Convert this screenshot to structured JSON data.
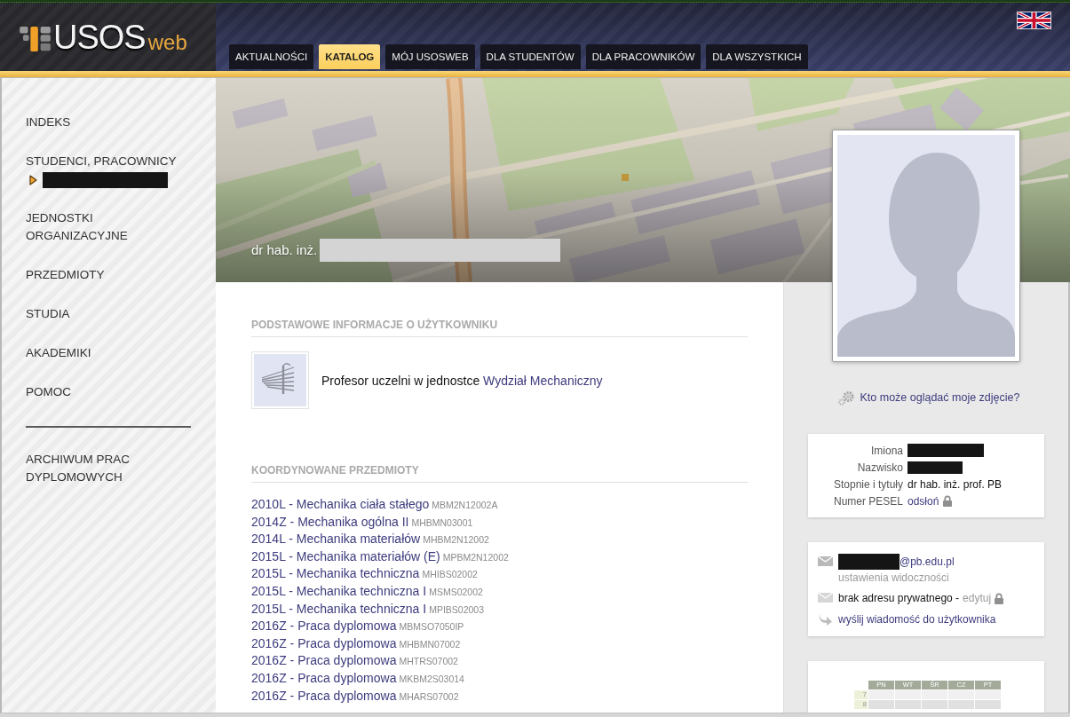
{
  "header": {
    "logo": {
      "main": "USOS",
      "suffix": "web"
    },
    "tabs": [
      {
        "label": "AKTUALNOŚCI",
        "selected": false
      },
      {
        "label": "KATALOG",
        "selected": true
      },
      {
        "label": "MÓJ USOSWEB",
        "selected": false
      },
      {
        "label": "DLA STUDENTÓW",
        "selected": false
      },
      {
        "label": "DLA PRACOWNIKÓW",
        "selected": false
      },
      {
        "label": "DLA WSZYSTKICH",
        "selected": false
      }
    ]
  },
  "sidebar": {
    "sections": [
      {
        "items": [
          {
            "label": "INDEKS",
            "expanded": false
          },
          {
            "label": "STUDENCI, PRACOWNICY",
            "expanded": true
          },
          {
            "label": "JEDNOSTKI ORGANIZACYJNE",
            "expanded": false
          },
          {
            "label": "PRZEDMIOTY",
            "expanded": false
          },
          {
            "label": "STUDIA",
            "expanded": false
          },
          {
            "label": "AKADEMIKI",
            "expanded": false
          },
          {
            "label": "POMOC",
            "expanded": false
          }
        ]
      },
      {
        "items": [
          {
            "label": "ARCHIWUM PRAC DYPLOMOWYCH",
            "expanded": false
          }
        ]
      }
    ]
  },
  "banner": {
    "name_prefix": "dr hab. inż."
  },
  "main": {
    "basic_info": {
      "heading": "PODSTAWOWE INFORMACJE O UŻYTKOWNIKU",
      "position_text": "Profesor uczelni w jednostce",
      "unit_link": "Wydział Mechaniczny"
    },
    "courses": {
      "heading": "KOORDYNOWANE PRZEDMIOTY",
      "items": [
        {
          "title": "2010L - Mechanika ciała stałego",
          "code": "MBM2N12002A"
        },
        {
          "title": "2014Z - Mechanika ogólna II",
          "code": "MHBMN03001"
        },
        {
          "title": "2014L - Mechanika materiałów",
          "code": "MHBM2N12002"
        },
        {
          "title": "2015L - Mechanika materiałów (E)",
          "code": "MPBM2N12002"
        },
        {
          "title": "2015L - Mechanika techniczna",
          "code": "MHIBS02002"
        },
        {
          "title": "2015L - Mechanika techniczna I",
          "code": "MSMS02002"
        },
        {
          "title": "2015L - Mechanika techniczna I",
          "code": "MPIBS02003"
        },
        {
          "title": "2016Z - Praca dyplomowa",
          "code": "MBMSO7050IP"
        },
        {
          "title": "2016Z - Praca dyplomowa",
          "code": "MHBMN07002"
        },
        {
          "title": "2016Z - Praca dyplomowa",
          "code": "MHTRS07002"
        },
        {
          "title": "2016Z - Praca dyplomowa",
          "code": "MKBM2S03014"
        },
        {
          "title": "2016Z - Praca dyplomowa",
          "code": "MHARS07002"
        }
      ]
    }
  },
  "profile": {
    "photo_link": "Kto może oglądać moje zdjęcie?",
    "details": [
      {
        "label": "Imiona",
        "kind": "redacted",
        "locked": false
      },
      {
        "label": "Nazwisko",
        "kind": "redacted",
        "locked": false
      },
      {
        "label": "Stopnie i tytuły",
        "kind": "text",
        "value": "dr hab. inż. prof. PB",
        "locked": false
      },
      {
        "label": "Numer PESEL",
        "kind": "link",
        "value": "odsłoń",
        "locked": true
      }
    ],
    "contacts": [
      {
        "kind": "email",
        "value": "@pb.edu.pl",
        "note": "ustawienia widoczności",
        "locked": false
      },
      {
        "kind": "private",
        "value": "brak adresu prywatnego -",
        "link": "edytuj",
        "locked": true
      },
      {
        "kind": "message",
        "link": "wyślij wiadomość do użytkownika",
        "locked": false
      }
    ],
    "timetable": {
      "days": [
        "PN",
        "WT",
        "ŚR",
        "CZ",
        "PT"
      ],
      "hours": [
        "7",
        "8"
      ]
    }
  }
}
